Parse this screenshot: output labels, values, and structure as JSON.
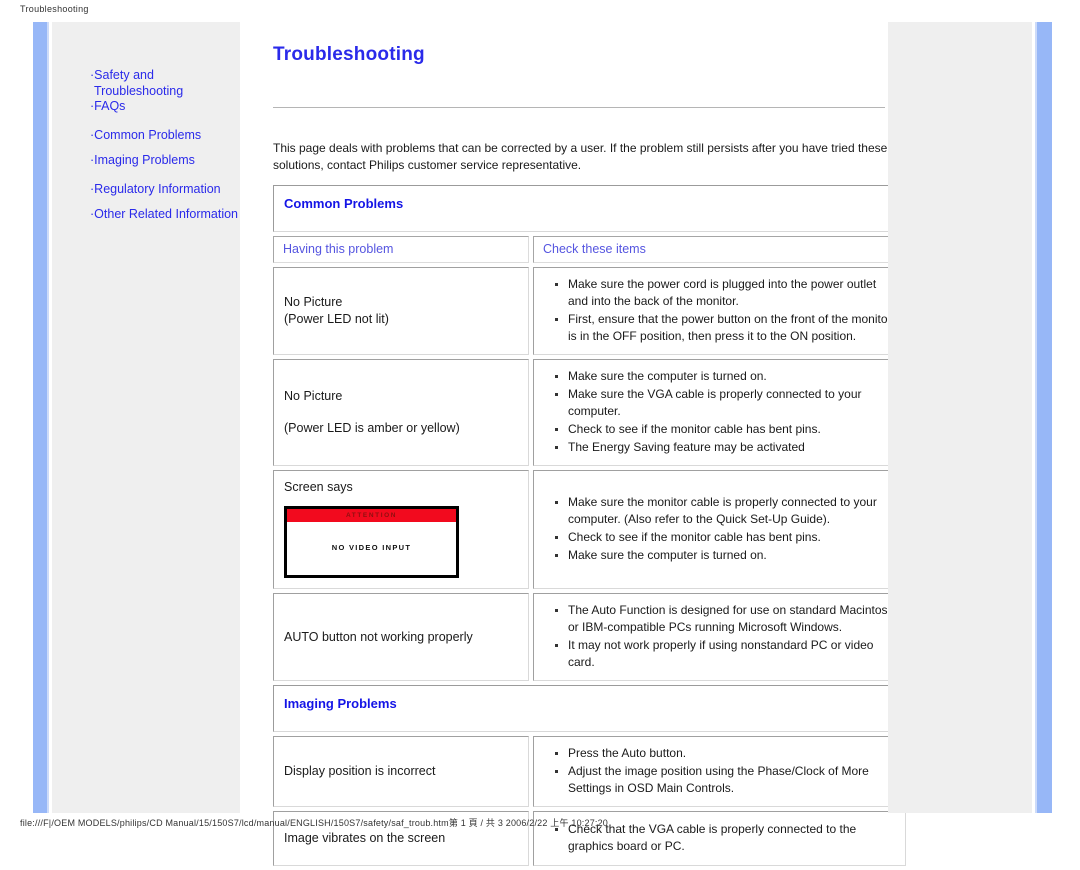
{
  "browser": {
    "header_title": "Troubleshooting",
    "footer_path": "file:///F|/OEM MODELS/philips/CD Manual/15/150S7/lcd/manual/ENGLISH/150S7/safety/saf_troub.htm第 1 頁 / 共 3 2006/2/22 上午 10:27:20"
  },
  "theme": {
    "link_blue": "#2a2aea",
    "heading_blue": "#1414e6",
    "subhead_blue": "#5555e0",
    "rail_blue": "#97b7f7",
    "panel_grey": "#efefef",
    "alert_red": "#f20a1e"
  },
  "sidebar": {
    "items": [
      {
        "label": "Safety and",
        "continuation": "Troubleshooting"
      },
      {
        "label": "FAQs"
      },
      {
        "label": "Common Problems"
      },
      {
        "label": "Imaging Problems"
      },
      {
        "label": "Regulatory Information"
      },
      {
        "label": "Other Related Information"
      }
    ]
  },
  "main": {
    "title": "Troubleshooting",
    "intro": "This page deals with problems that can be corrected by a user. If the problem still persists after you have tried these solutions, contact Philips customer service representative.",
    "column_headers": {
      "problem": "Having this problem",
      "check": "Check these items"
    },
    "sections": [
      {
        "heading": "Common Problems",
        "rows": [
          {
            "problem_line1": "No Picture",
            "problem_line2": "(Power LED not lit)",
            "checks": [
              "Make sure the power cord is plugged into the power outlet and into the back of the monitor.",
              "First, ensure that the power button on the front of the monitor is in the OFF position, then press it to the ON position."
            ]
          },
          {
            "problem_line1": "No Picture",
            "problem_line2": "(Power LED is amber or yellow)",
            "checks": [
              "Make sure the computer is turned on.",
              "Make sure the VGA cable is properly connected to your computer.",
              "Check to see if the monitor cable has bent pins.",
              "The Energy Saving feature may be activated"
            ]
          },
          {
            "problem_line1": "Screen says",
            "graphic": {
              "banner": "ATTENTION",
              "message": "NO VIDEO INPUT"
            },
            "checks": [
              "Make sure the monitor cable is properly connected to your computer. (Also refer to the Quick Set-Up Guide).",
              "Check to see if the monitor cable has bent pins.",
              "Make sure the computer is turned on."
            ]
          },
          {
            "problem_line1": "AUTO button not working properly",
            "checks": [
              "The Auto Function is designed for use on standard Macintosh or IBM-compatible PCs running Microsoft Windows.",
              "It may not work properly if using nonstandard PC or video card."
            ]
          }
        ]
      },
      {
        "heading": "Imaging Problems",
        "rows": [
          {
            "problem_line1": "Display position is incorrect",
            "checks": [
              "Press the Auto button.",
              "Adjust the image position using the Phase/Clock of More Settings in OSD Main Controls."
            ]
          },
          {
            "problem_line1": "Image vibrates on the screen",
            "checks": [
              "Check that the VGA cable is properly connected to the graphics board or PC."
            ]
          }
        ]
      }
    ]
  }
}
